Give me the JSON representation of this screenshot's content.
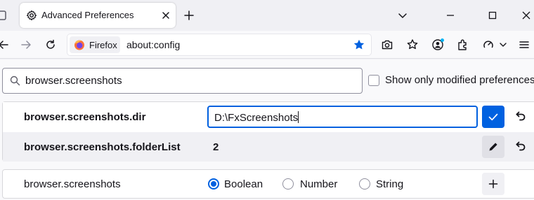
{
  "tab": {
    "title": "Advanced Preferences"
  },
  "urlbar": {
    "identity_label": "Firefox",
    "url": "about:config"
  },
  "search": {
    "value": "browser.screenshots"
  },
  "modified_only": {
    "label": "Show only modified preferences",
    "checked": false
  },
  "prefs": [
    {
      "name": "browser.screenshots.dir",
      "value": "D:\\FxScreenshots",
      "editing": true
    },
    {
      "name": "browser.screenshots.folderList",
      "value": "2",
      "editing": false
    }
  ],
  "new_pref": {
    "name": "browser.screenshots",
    "types": [
      "Boolean",
      "Number",
      "String"
    ],
    "selected_type": "Boolean"
  },
  "colors": {
    "accent": "#0061e0",
    "toolbar": "#f9f9fb",
    "tabstrip": "#f0f0f4"
  },
  "icons": [
    "settings-icon",
    "close-icon",
    "plus-icon",
    "chevron-down-icon",
    "minimize-icon",
    "maximize-icon",
    "back-icon",
    "forward-icon",
    "reload-icon",
    "firefox-logo",
    "star-icon",
    "screenshot-icon",
    "pocket-icon",
    "account-icon",
    "extensions-icon",
    "sync-icon",
    "menu-icon",
    "search-icon",
    "check-icon",
    "undo-icon",
    "pencil-icon"
  ]
}
